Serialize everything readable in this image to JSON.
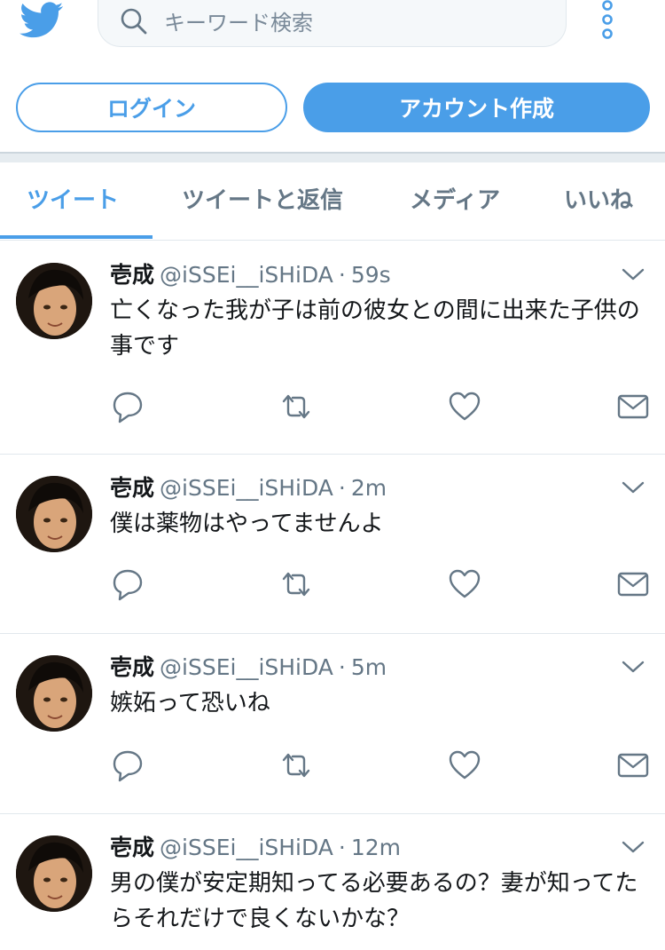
{
  "header": {
    "logo": "twitter-bird-icon",
    "search_placeholder": "キーワード検索",
    "menu_icon": "more-vertical-icon"
  },
  "auth": {
    "login_label": "ログイン",
    "signup_label": "アカウント作成"
  },
  "tabs": [
    {
      "label": "ツイート",
      "active": true
    },
    {
      "label": "ツイートと返信",
      "active": false
    },
    {
      "label": "メディア",
      "active": false
    },
    {
      "label": "いいね",
      "active": false
    }
  ],
  "tweets": [
    {
      "name": "壱成",
      "handle": "@iSSEi__iSHiDA",
      "dot": "·",
      "time": "59s",
      "text": "亡くなった我が子は前の彼女との間に出来た子供の事です"
    },
    {
      "name": "壱成",
      "handle": "@iSSEi__iSHiDA",
      "dot": "·",
      "time": "2m",
      "text": "僕は薬物はやってませんよ"
    },
    {
      "name": "壱成",
      "handle": "@iSSEi__iSHiDA",
      "dot": "·",
      "time": "5m",
      "text": "嫉妬って恐いね"
    },
    {
      "name": "壱成",
      "handle": "@iSSEi__iSHiDA",
      "dot": "·",
      "time": "12m",
      "text": "男の僕が安定期知ってる必要あるの？妻が知ってたらそれだけで良くないかな？"
    }
  ],
  "colors": {
    "accent": "#4a9ee8",
    "muted": "#657786",
    "divider": "#e1e8ed"
  }
}
